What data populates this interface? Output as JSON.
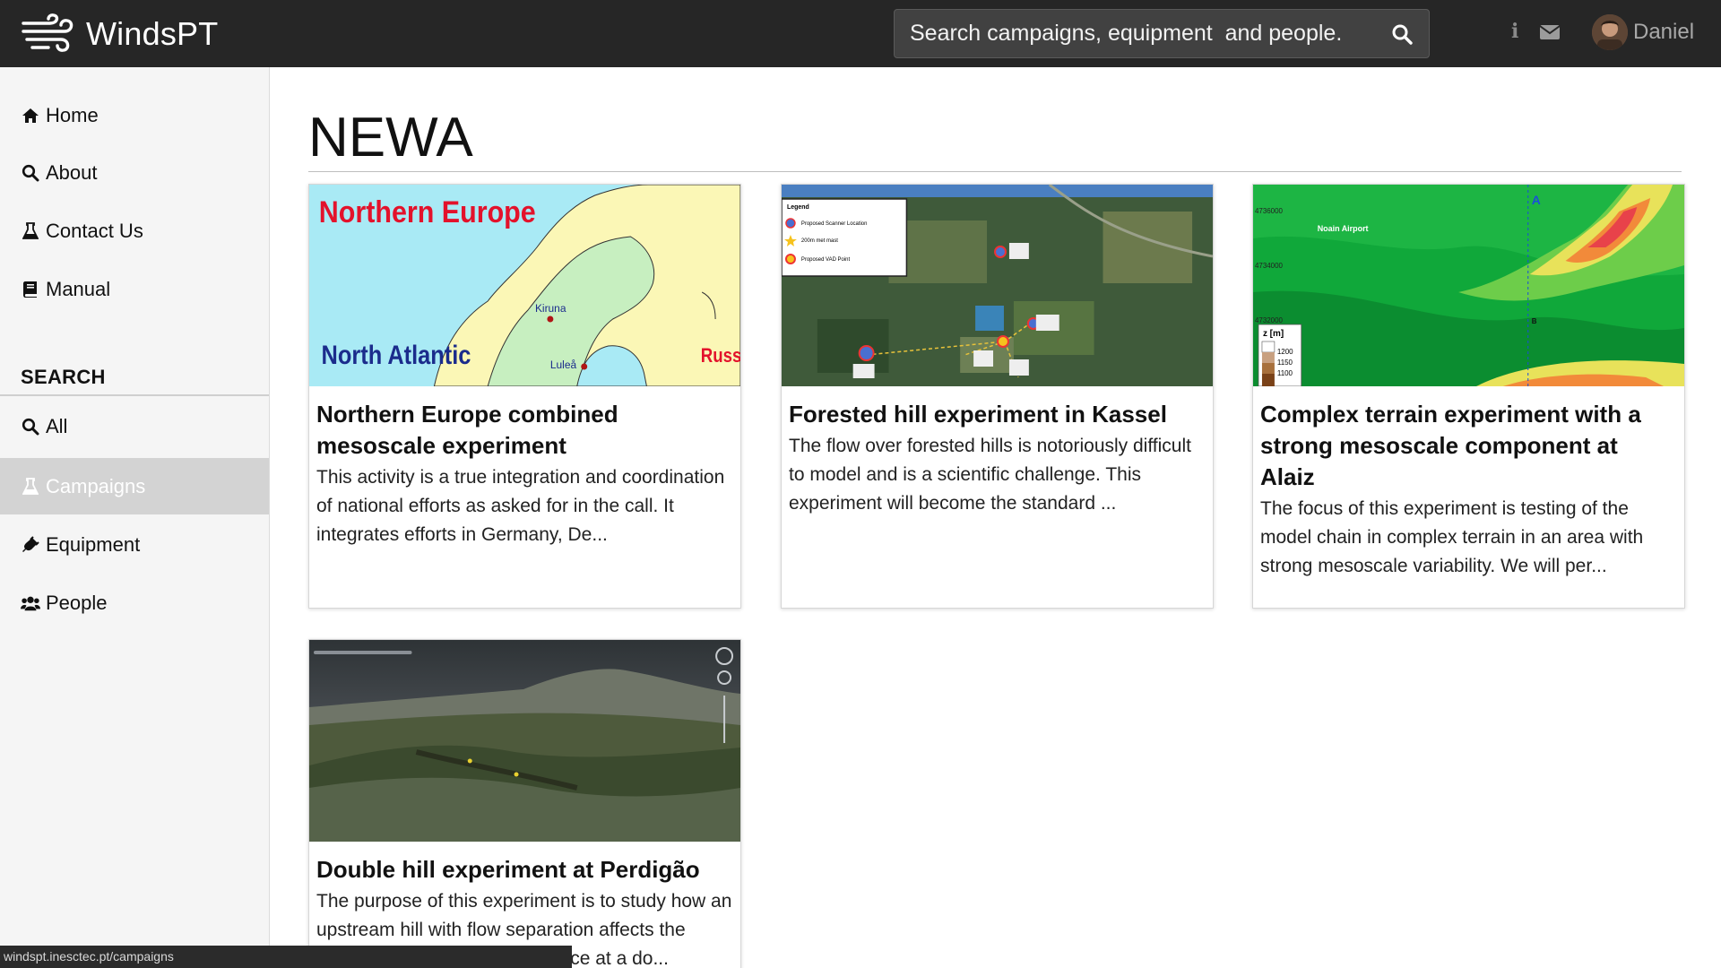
{
  "app": {
    "name": "WindsPT"
  },
  "search": {
    "placeholder": "Search campaigns, equipment  and people."
  },
  "user": {
    "name": "Daniel"
  },
  "sidebar": {
    "nav": [
      {
        "label": "Home",
        "icon": "home-icon"
      },
      {
        "label": "About",
        "icon": "search-icon"
      },
      {
        "label": "Contact Us",
        "icon": "flask-icon"
      },
      {
        "label": "Manual",
        "icon": "book-icon"
      }
    ],
    "search_heading": "SEARCH",
    "search_items": [
      {
        "label": "All",
        "icon": "search-icon"
      },
      {
        "label": "Campaigns",
        "icon": "flask-icon",
        "active": true
      },
      {
        "label": "Equipment",
        "icon": "plug-icon"
      },
      {
        "label": "People",
        "icon": "users-icon"
      }
    ]
  },
  "main": {
    "title": "NEWA",
    "cards": [
      {
        "title": "Northern Europe combined mesoscale experiment",
        "description": "This activity is a true integration and coordination of national efforts as asked for in the call. It integrates efforts in Germany, De...",
        "image_labels": [
          "Northern Europe",
          "North Atlantic",
          "Russia",
          "Kiruna",
          "Luleå"
        ]
      },
      {
        "title": "Forested hill experiment in Kassel",
        "description": "The flow over forested hills is notoriously difficult to model and is a scientific challenge. This experiment will become the standard ...",
        "image_labels": [
          "Legend",
          "Proposed Scanner Location",
          "200m met mast",
          "Proposed VAD Point"
        ]
      },
      {
        "title": "Complex terrain experiment with a strong mesoscale component at Alaiz",
        "description": "The focus of this experiment is testing of the model chain in complex terrain in an area with strong mesoscale variability. We will per...",
        "image_labels": [
          "Noain Airport",
          "4736000",
          "4734000",
          "4732000",
          "z [m]",
          "1200",
          "1150",
          "1100",
          "A",
          "B"
        ]
      },
      {
        "title": "Double hill experiment at Perdigão",
        "description": "The purpose of this experiment is to study how an upstream hill with flow separation affects the downstream hill. This experience at a do..."
      }
    ]
  },
  "status_url": "windspt.inesctec.pt/campaigns",
  "colors": {
    "topbar": "#262626",
    "sidebar": "#f5f5f5",
    "active_nav": "#d3d3d3"
  }
}
